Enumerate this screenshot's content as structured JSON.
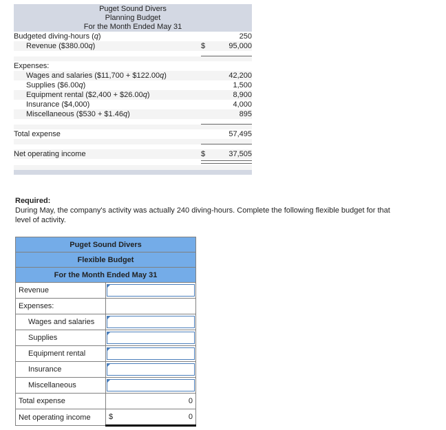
{
  "planning_budget": {
    "title_lines": [
      "Puget Sound Divers",
      "Planning Budget",
      "For the Month Ended May 31"
    ],
    "rows": [
      {
        "label": "Budgeted diving-hours (q)",
        "symbol": "",
        "value": "250"
      },
      {
        "label": "Revenue ($380.00q)",
        "symbol": "$",
        "value": "95,000"
      },
      {
        "label": "Expenses:",
        "symbol": "",
        "value": ""
      },
      {
        "label": "Wages and salaries ($11,700 + $122.00q)",
        "symbol": "",
        "value": "42,200"
      },
      {
        "label": "Supplies ($6.00q)",
        "symbol": "",
        "value": "1,500"
      },
      {
        "label": "Equipment rental ($2,400 + $26.00q)",
        "symbol": "",
        "value": "8,900"
      },
      {
        "label": "Insurance ($4,000)",
        "symbol": "",
        "value": "4,000"
      },
      {
        "label": "Miscellaneous ($530 + $1.46q)",
        "symbol": "",
        "value": "895"
      },
      {
        "label": "Total expense",
        "symbol": "",
        "value": "57,495"
      },
      {
        "label": "Net operating income",
        "symbol": "$",
        "value": "37,505"
      }
    ]
  },
  "required": {
    "title": "Required:",
    "text": "During May, the company's activity was actually 240 diving-hours. Complete the following flexible budget for that level of activity."
  },
  "flexible_budget": {
    "header_lines": [
      "Puget Sound Divers",
      "Flexible Budget",
      "For the Month Ended May 31"
    ],
    "rows": [
      {
        "label": "Revenue",
        "type": "entry",
        "value": "",
        "symbol": ""
      },
      {
        "label": "Expenses:",
        "type": "blank",
        "value": "",
        "symbol": ""
      },
      {
        "label": "Wages and salaries",
        "type": "entry",
        "value": "",
        "symbol": ""
      },
      {
        "label": "Supplies",
        "type": "entry",
        "value": "",
        "symbol": ""
      },
      {
        "label": "Equipment rental",
        "type": "entry",
        "value": "",
        "symbol": ""
      },
      {
        "label": "Insurance",
        "type": "entry",
        "value": "",
        "symbol": ""
      },
      {
        "label": "Miscellaneous",
        "type": "entry",
        "value": "",
        "symbol": ""
      },
      {
        "label": "Total expense",
        "type": "readonly",
        "value": "0",
        "symbol": ""
      },
      {
        "label": "Net operating income",
        "type": "readonly",
        "value": "0",
        "symbol": "$"
      }
    ]
  },
  "colors": {
    "report_header_bg": "#d3d8e3",
    "worksheet_header_bg": "#74ace8",
    "entry_border": "#4a7ebb",
    "shade_row": "#f4f4f4"
  }
}
